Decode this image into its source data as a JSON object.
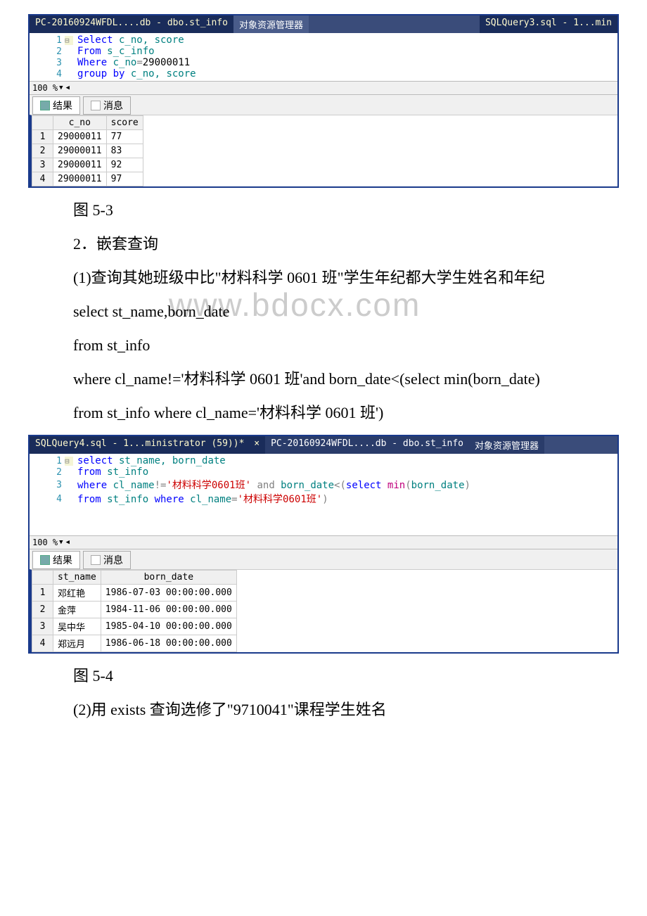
{
  "screenshot1": {
    "tabs": {
      "active": "PC-20160924WFDL....db - dbo.st_info",
      "mid": "对象资源管理器",
      "right": "SQLQuery3.sql - 1...min"
    },
    "code": {
      "l1a": "Select",
      "l1b": " c_no, score",
      "l2a": "From",
      "l2b": " s_c_info",
      "l3a": "Where",
      "l3b": " c_no",
      "l3c": "=",
      "l3d": "29000011",
      "l4a": "group",
      "l4b": " by",
      "l4c": " c_no, score"
    },
    "zoom": "100 %",
    "resultTabs": {
      "results": "结果",
      "messages": "消息"
    },
    "columns": {
      "c1": "c_no",
      "c2": "score"
    },
    "rows": [
      {
        "n": "1",
        "c_no": "29000011",
        "score": "77"
      },
      {
        "n": "2",
        "c_no": "29000011",
        "score": "83"
      },
      {
        "n": "3",
        "c_no": "29000011",
        "score": "92"
      },
      {
        "n": "4",
        "c_no": "29000011",
        "score": "97"
      }
    ]
  },
  "caption1": "图 5-3",
  "heading2": "2．嵌套查询",
  "para1": "(1)查询其她班级中比\"材料科学 0601 班\"学生年纪都大学生姓名和年纪",
  "code1_l1": "select st_name,born_date",
  "code1_l2": "from st_info",
  "watermark": "www.bdocx.com",
  "code1_l3": "where cl_name!='材料科学 0601 班'and born_date<(select min(born_date)",
  "code1_l4": "from st_info where cl_name='材料科学 0601 班')",
  "screenshot2": {
    "tabs": {
      "left": "SQLQuery4.sql - 1...ministrator (59))*",
      "close": "×",
      "mid": "PC-20160924WFDL....db - dbo.st_info",
      "right": "对象资源管理器"
    },
    "code": {
      "l1_kw": "select",
      "l1_rest": " st_name, born_date",
      "l2_kw": "from",
      "l2_rest": " st_info",
      "l3_a": "where",
      "l3_b": " cl_name",
      "l3_c": "!=",
      "l3_d": "'材料科学0601班'",
      "l3_e": " and",
      "l3_f": " born_date",
      "l3_g": "<(",
      "l3_h": "select",
      "l3_i": " min",
      "l3_j": "(",
      "l3_k": "born_date",
      "l3_l": ")",
      "l4_a": "from",
      "l4_b": " st_info ",
      "l4_c": "where",
      "l4_d": " cl_name",
      "l4_e": "=",
      "l4_f": "'材料科学0601班'",
      "l4_g": ")"
    },
    "zoom": "100 %",
    "resultTabs": {
      "results": "结果",
      "messages": "消息"
    },
    "columns": {
      "c1": "st_name",
      "c2": "born_date"
    },
    "rows": [
      {
        "n": "1",
        "name": "邓红艳",
        "date": "1986-07-03 00:00:00.000"
      },
      {
        "n": "2",
        "name": "金萍",
        "date": "1984-11-06 00:00:00.000"
      },
      {
        "n": "3",
        "name": "吴中华",
        "date": "1985-04-10 00:00:00.000"
      },
      {
        "n": "4",
        "name": "郑远月",
        "date": "1986-06-18 00:00:00.000"
      }
    ]
  },
  "caption2": "图 5-4",
  "para2": "(2)用 exists 查询选修了\"9710041\"课程学生姓名"
}
